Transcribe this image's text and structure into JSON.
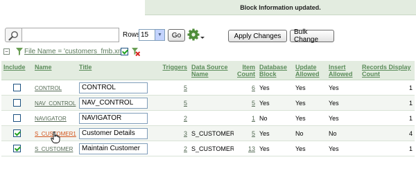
{
  "banner": {
    "message": "Block Information updated."
  },
  "toolbar": {
    "search_value": "",
    "rows_label": "Rows",
    "rows_value": "15",
    "go_label": "Go",
    "apply_label": "Apply Changes",
    "bulk_label": "Bulk Change"
  },
  "filter": {
    "text": "File Name = 'customers_fmb.xml'"
  },
  "table": {
    "headers": {
      "include": "Include",
      "name": "Name",
      "title": "Title",
      "triggers": "Triggers",
      "data_source": "Data Source Name",
      "item_count": "Item Count",
      "database_block": "Database Block",
      "update_allowed": "Update Allowed",
      "insert_allowed": "Insert Allowed",
      "records_display": "Records Display Count"
    },
    "rows": [
      {
        "include": false,
        "name": "CONTROL",
        "title": "CONTROL",
        "triggers": "5",
        "data_source": "",
        "item_count": "6",
        "database_block": "Yes",
        "update_allowed": "Yes",
        "insert_allowed": "Yes",
        "records_display": "1"
      },
      {
        "include": false,
        "name": "NAV_CONTROL",
        "title": "NAV_CONTROL",
        "triggers": "5",
        "data_source": "",
        "item_count": "5",
        "database_block": "Yes",
        "update_allowed": "Yes",
        "insert_allowed": "Yes",
        "records_display": "1"
      },
      {
        "include": false,
        "name": "NAVIGATOR",
        "title": "NAVIGATOR",
        "triggers": "2",
        "data_source": "",
        "item_count": "1",
        "database_block": "No",
        "update_allowed": "Yes",
        "insert_allowed": "Yes",
        "records_display": "1"
      },
      {
        "include": true,
        "name": "S_CUSTOMER1",
        "title": "Customer Details",
        "triggers": "3",
        "data_source": "S_CUSTOMER",
        "item_count": "5",
        "database_block": "Yes",
        "update_allowed": "No",
        "insert_allowed": "No",
        "records_display": "4"
      },
      {
        "include": true,
        "name": "S_CUSTOMER",
        "title": "Maintain Customer",
        "triggers": "2",
        "data_source": "S_CUSTOMER",
        "item_count": "13",
        "database_block": "Yes",
        "update_allowed": "Yes",
        "insert_allowed": "Yes",
        "records_display": "1"
      }
    ]
  },
  "colors": {
    "header_bg": "#e3ece0",
    "header_text": "#5b8c5a",
    "active_link": "#d2541b"
  },
  "icons": {
    "search": "magnifier-icon",
    "actions": "gear-icon",
    "filter": "funnel-icon",
    "remove_filter": "remove-filter-icon",
    "cursor": "hand-cursor-icon"
  }
}
